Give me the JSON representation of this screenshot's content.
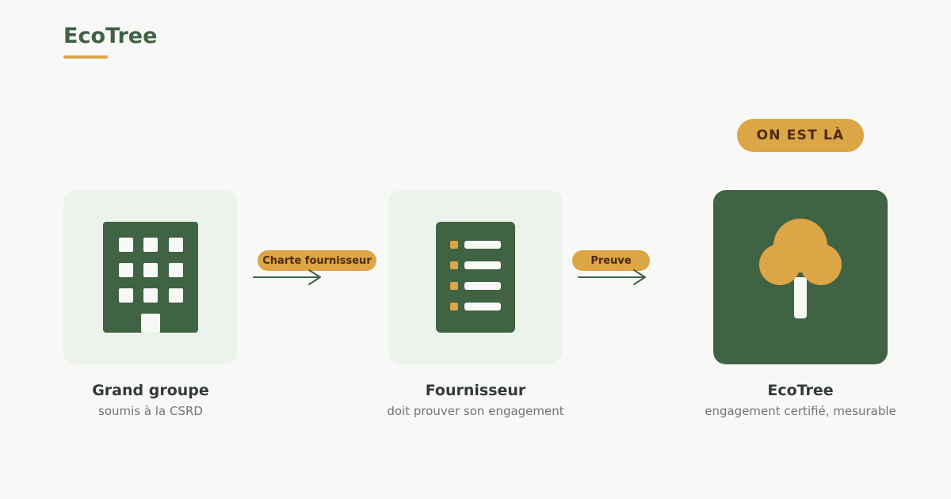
{
  "brand": {
    "name": "EcoTree"
  },
  "badge": {
    "label": "ON EST LÀ"
  },
  "colors": {
    "primary_green": "#3f6343",
    "accent_gold": "#dca546",
    "tile_light": "#ebf3ec",
    "background": "#f8f8f7",
    "text_dark": "#323a36",
    "text_muted": "#6f7572"
  },
  "steps": [
    {
      "title": "Grand groupe",
      "subtitle": "soumis à la CSRD",
      "icon": "building-icon"
    },
    {
      "title": "Fournisseur",
      "subtitle": "doit prouver son engagement",
      "icon": "checklist-icon"
    },
    {
      "title": "EcoTree",
      "subtitle": "engagement certifié, mesurable",
      "icon": "tree-icon"
    }
  ],
  "connectors": [
    {
      "label": "Charte fournisseur"
    },
    {
      "label": "Preuve"
    }
  ]
}
